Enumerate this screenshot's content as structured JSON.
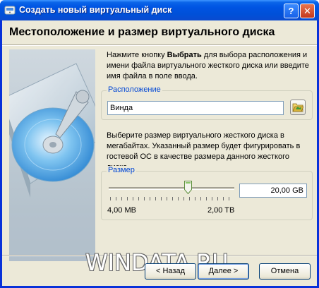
{
  "window": {
    "title": "Создать новый виртуальный диск",
    "help_label": "?",
    "close_label": "✕"
  },
  "header": {
    "title": "Местоположение и размер виртуального диска"
  },
  "location": {
    "desc_pre": "Нажмите кнопку ",
    "desc_bold": "Выбрать",
    "desc_post": " для выбора расположения и имени файла виртуального жесткого диска или введите имя файла в поле ввода.",
    "group_label": "Расположение",
    "value": "Винда",
    "browse_icon": "folder-open-icon"
  },
  "size": {
    "description": "Выберите размер виртуального жесткого диска в мегабайтах. Указанный размер будет фигурировать в гостевой ОС в качестве размера данного жесткого диска.",
    "group_label": "Размер",
    "value": "20,00 GB",
    "min_label": "4,00 MB",
    "max_label": "2,00 TB",
    "slider_fraction": 0.63
  },
  "buttons": {
    "back": "< Назад",
    "next": "Далее >",
    "cancel": "Отмена"
  },
  "watermark": "WINDATA.RU",
  "colors": {
    "titlebar": "#0054e3",
    "dialog_bg": "#ece9d8",
    "group_label": "#0046d5",
    "input_border": "#7f9db9"
  }
}
